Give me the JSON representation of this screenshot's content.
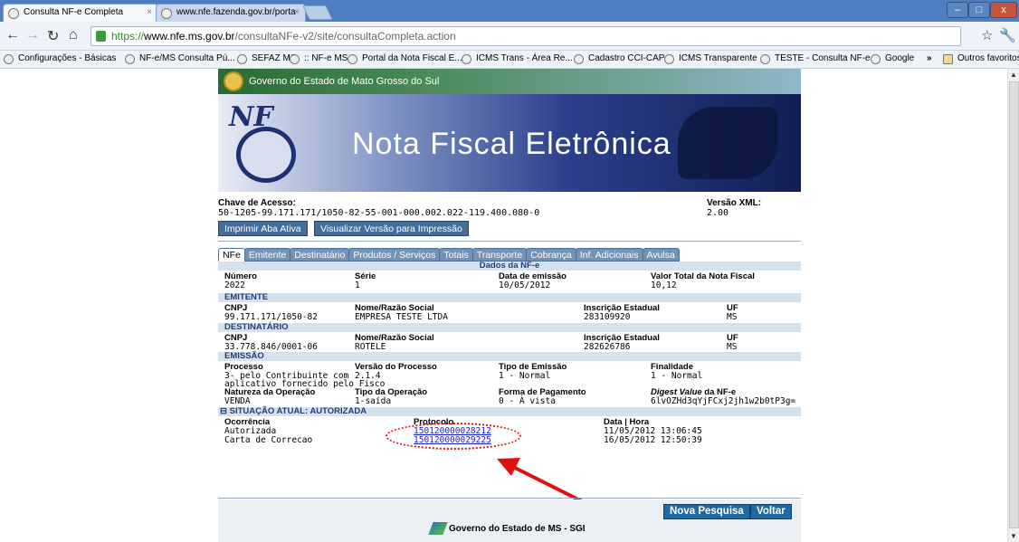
{
  "browser": {
    "tabs": [
      {
        "title": "Consulta NF-e Completa",
        "close": "×"
      },
      {
        "title": "www.nfe.fazenda.gov.br/porta",
        "close": "×"
      }
    ],
    "url": {
      "scheme": "https://",
      "host": "www.nfe.ms.gov.br",
      "path": "/consultaNFe-v2/site/consultaCompleta.action"
    },
    "bookmarks": [
      "Configurações - Básicas",
      "NF-e/MS Consulta Pú...",
      "SEFAZ MS",
      ":: NF-e MS",
      "Portal da Nota Fiscal E...",
      "ICMS Trans - Área Re...",
      "Cadastro CCI-CAP",
      "ICMS Transparente",
      "TESTE - Consulta NF-e",
      "Google"
    ],
    "bookmarks_more": "»",
    "other_bookmarks": "Outros favoritos"
  },
  "header": {
    "gov_title": "Governo do Estado de Mato Grosso do Sul",
    "logo_text": "NF",
    "banner_title": "Nota Fiscal Eletrônica"
  },
  "access": {
    "chave_label": "Chave de Acesso:",
    "chave_value": "50-1205-99.171.171/1050-82-55-001-000.002.022-119.400.080-0",
    "versao_label": "Versão XML:",
    "versao_value": "2.00"
  },
  "actions": {
    "print_tab": "Imprimir Aba Ativa",
    "print_view": "Visualizar Versão para Impressão"
  },
  "tabs": [
    "NFe",
    "Emitente",
    "Destinatário",
    "Produtos / Serviços",
    "Totais",
    "Transporte",
    "Cobrança",
    "Inf. Adicionais",
    "Avulsa"
  ],
  "dados": {
    "title": "Dados da NF-e",
    "numero_label": "Número",
    "numero": "2022",
    "serie_label": "Série",
    "serie": "1",
    "data_label": "Data de emissão",
    "data": "10/05/2012",
    "valor_label": "Valor Total da Nota Fiscal",
    "valor": "10,12"
  },
  "emitente": {
    "title": "EMITENTE",
    "cnpj_label": "CNPJ",
    "cnpj": "99.171.171/1050-82",
    "nome_label": "Nome/Razão Social",
    "nome": "EMPRESA TESTE LTDA",
    "ie_label": "Inscrição Estadual",
    "ie": "283109920",
    "uf_label": "UF",
    "uf": "MS"
  },
  "destinatario": {
    "title": "DESTINATÁRIO",
    "cnpj_label": "CNPJ",
    "cnpj": "33.778.846/0001-06",
    "nome_label": "Nome/Razão Social",
    "nome": "ROTELE",
    "ie_label": "Inscrição Estadual",
    "ie": "282626786",
    "uf_label": "UF",
    "uf": "MS"
  },
  "emissao": {
    "title": "EMISSÃO",
    "processo_label": "Processo",
    "processo_1": "3- pelo Contribuinte com",
    "processo_2": "aplicativo fornecido pelo Fisco",
    "versao_proc_label": "Versão do Processo",
    "versao_proc": "2.1.4",
    "tipo_emissao_label": "Tipo de Emissão",
    "tipo_emissao": "1 - Normal",
    "finalidade_label": "Finalidade",
    "finalidade": "1 - Normal",
    "natureza_label": "Natureza da Operação",
    "natureza": "VENDA",
    "tipo_op_label": "Tipo da Operação",
    "tipo_op": "1-saída",
    "forma_pag_label": "Forma de Pagamento",
    "forma_pag": "0 - À vista",
    "digest_label_em": "Digest Value",
    "digest_label_rest": " da NF-e",
    "digest": "6lvOZHd3qYjFCxj2jh1w2b0tP3g="
  },
  "situacao": {
    "toggle": "⊟",
    "title": "SITUAÇÃO ATUAL: AUTORIZADA",
    "ocorrencia_label": "Ocorrência",
    "protocolo_label": "Protocolo",
    "data_hora_label": "Data | Hora",
    "rows": [
      {
        "ocorrencia": "Autorizada",
        "protocolo": "150120000028212",
        "data_hora": "11/05/2012 13:06:45"
      },
      {
        "ocorrencia": "Carta de Correcao",
        "protocolo": "150120000029225",
        "data_hora": "16/05/2012 12:50:39"
      }
    ]
  },
  "footer": {
    "nova_pesquisa": "Nova Pesquisa",
    "voltar": "Voltar",
    "gov": "Governo do Estado de MS - SGI"
  },
  "colors": {
    "accent": "#466d9b",
    "header_bar": "#d7e1ee",
    "annotation": "#e01010",
    "link": "#1a1fc3"
  }
}
